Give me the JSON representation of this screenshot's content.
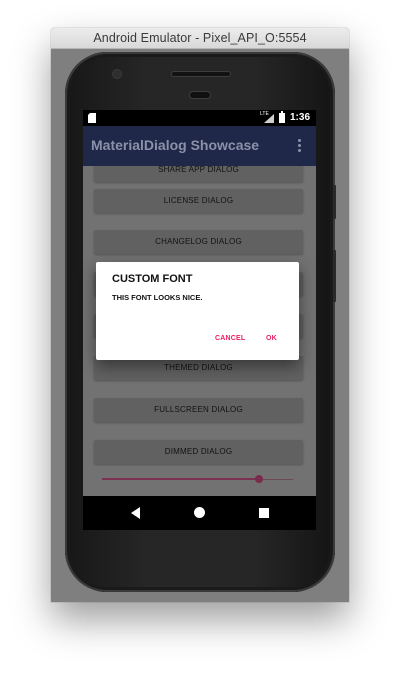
{
  "window": {
    "title": "Android Emulator - Pixel_API_O:5554"
  },
  "status_bar": {
    "network": "LTE",
    "time": "1:36"
  },
  "app_bar": {
    "title": "MaterialDialog Showcase"
  },
  "buttons": [
    {
      "label": "SHARE APP DIALOG"
    },
    {
      "label": "LICENSE DIALOG"
    },
    {
      "label": "CHANGELOG DIALOG"
    },
    {
      "label": ""
    },
    {
      "label": ""
    },
    {
      "label": "THEMED DIALOG"
    },
    {
      "label": "FULLSCREEN DIALOG"
    },
    {
      "label": "DIMMED DIALOG"
    }
  ],
  "slider": {
    "value_fraction": 0.82
  },
  "dialog": {
    "title": "CUSTOM FONT",
    "message": "THIS FONT LOOKS NICE.",
    "cancel_label": "CANCEL",
    "ok_label": "OK"
  },
  "colors": {
    "app_bar": "#20284a",
    "accent": "#e91e63",
    "scrim_background": "#727272"
  },
  "icons": [
    "sd-card-icon",
    "signal-icon",
    "battery-icon",
    "overflow-menu-icon",
    "back-icon",
    "home-icon",
    "recents-icon"
  ]
}
